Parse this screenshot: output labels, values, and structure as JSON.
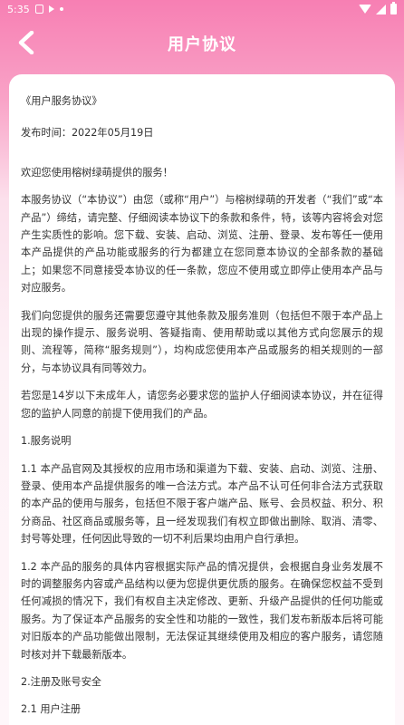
{
  "status_bar": {
    "time": "5:35"
  },
  "header": {
    "title": "用户协议"
  },
  "colors": {
    "header_pink": "#f77fb3",
    "card_bg": "#ffffff",
    "text": "#333333"
  },
  "content": {
    "doc_title": "《用户服务协议》",
    "publish_date": "发布时间：2022年05月19日",
    "welcome": "欢迎您使用榕树绿萌提供的服务！",
    "p1": "本服务协议（“本协议”）由您（或称“用户”）与榕树绿萌的开发者（“我们”或“本产品”）缔结，请完整、仔细阅读本协议下的条款和条件，特，该等内容将会对您产生实质性的影响。您下载、安装、启动、浏览、注册、登录、发布等任一使用本产品提供的产品功能或服务的行为都建立在您同意本协议的全部条款的基础上；如果您不同意接受本协议的任一条款，您应不使用或立即停止使用本产品与对应服务。",
    "p2": "我们向您提供的服务还需要您遵守其他条款及服务准则（包括但不限于本产品上出现的操作提示、服务说明、答疑指南、使用帮助或以其他方式向您展示的规则、流程等，简称“服务规则”），均构成您使用本产品或服务的相关规则的一部分，与本协议具有同等效力。",
    "p3": "若您是14岁以下未成年人，请您务必要求您的监护人仔细阅读本协议，并在征得您的监护人同意的前提下使用我们的产品。",
    "s1": "1.服务说明",
    "s1_1": "1.1 本产品官网及其授权的应用市场和渠道为下载、安装、启动、浏览、注册、登录、使用本产品提供服务的唯一合法方式。本产品不认可任何非合法方式获取的本产品的使用与服务，包括但不限于客户端产品、账号、会员权益、积分、积分商品、社区商品或服务等，且一经发现我们有权立即做出删除、取消、清零、封号等处理，任何因此导致的一切不利后果均由用户自行承担。",
    "s1_2": "1.2 本产品的服务的具体内容根据实际产品的情况提供，会根据自身业务发展不时的调整服务内容或产品结构以便为您提供更优质的服务。在确保您权益不受到任何减损的情况下，我们有权自主决定修改、更新、升级产品提供的任何功能或服务。为了保证本产品服务的安全性和功能的一致性，我们发布新版本后将可能对旧版本的产品功能做出限制，无法保证其继续使用及相应的客户服务，请您随时核对并下载最新版本。",
    "s2": "2.注册及账号安全",
    "s2_1": "2.1 用户注册"
  }
}
